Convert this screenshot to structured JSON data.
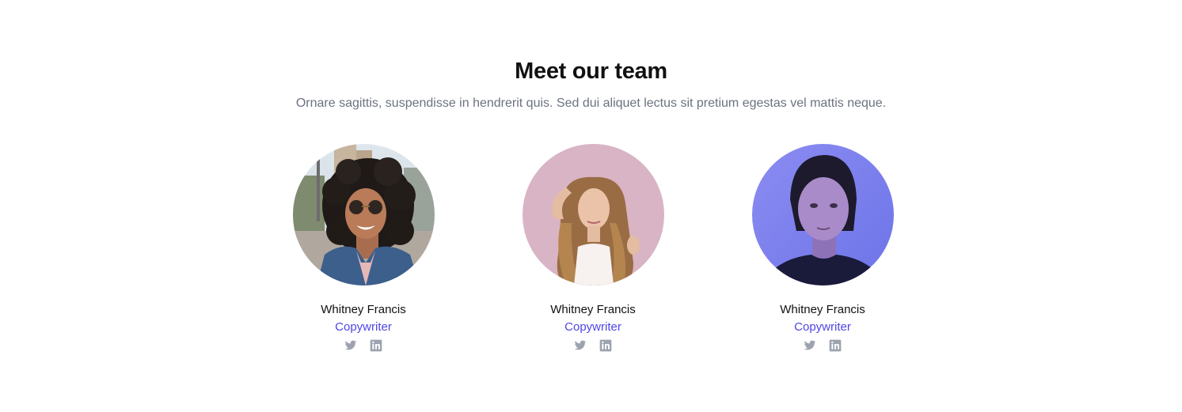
{
  "section": {
    "title": "Meet our team",
    "subtitle": "Ornare sagittis, suspendisse in hendrerit quis. Sed dui aliquet lectus sit pretium egestas vel mattis neque."
  },
  "colors": {
    "role": "#4f46e5",
    "icon": "#9ca3af",
    "subtitle": "#6b7280"
  },
  "members": [
    {
      "name": "Whitney Francis",
      "role": "Copywriter",
      "photo": "woman-curly-hair-sunglasses",
      "socials": [
        "twitter-icon",
        "linkedin-icon"
      ]
    },
    {
      "name": "Whitney Francis",
      "role": "Copywriter",
      "photo": "woman-long-wavy-hair-pink-background",
      "socials": [
        "twitter-icon",
        "linkedin-icon"
      ]
    },
    {
      "name": "Whitney Francis",
      "role": "Copywriter",
      "photo": "woman-portrait-blue-light",
      "socials": [
        "twitter-icon",
        "linkedin-icon"
      ]
    }
  ]
}
